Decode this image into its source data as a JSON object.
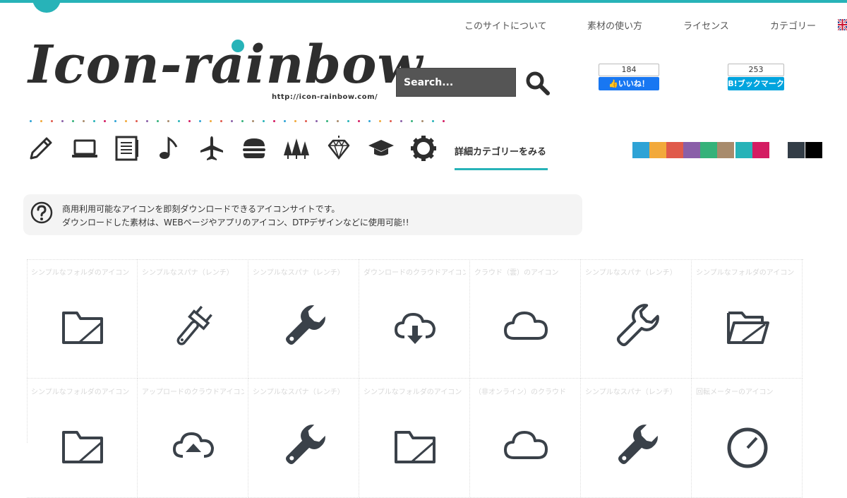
{
  "nav": {
    "items": [
      "このサイトについて",
      "素材の使い方",
      "ライセンス",
      "カテゴリー"
    ]
  },
  "logo": {
    "text": "Icon-rainbow",
    "url": "http://icon-rainbow.com/"
  },
  "search": {
    "placeholder": "Search..."
  },
  "social": {
    "facebook": {
      "count": "184",
      "label": "いいね！"
    },
    "hatena": {
      "count": "253",
      "label": "B!ブックマーク"
    }
  },
  "categories": {
    "icons": [
      "pencil-icon",
      "laptop-icon",
      "notebook-icon",
      "music-note-icon",
      "airplane-icon",
      "hamburger-icon",
      "trees-icon",
      "diamond-icon",
      "graduation-cap-icon",
      "gear-icon"
    ],
    "detail_link": "詳細カテゴリーをみる"
  },
  "colors": {
    "accent": "#27b3b8",
    "swatches": [
      "#2ea3d6",
      "#f2a93b",
      "#e05a4b",
      "#8a5fa8",
      "#35b27a",
      "#a88b6c",
      "#27b3b8",
      "#d41c62",
      "#ffffff",
      "#333d47",
      "#000000"
    ]
  },
  "info": {
    "line1": "商用利用可能なアイコンを即刻ダウンロードできるアイコンサイトです。",
    "line2": "ダウンロードした素材は、WEBページやアプリのアイコン、DTPデザインなどに使用可能!!"
  },
  "icon_grid": {
    "row1": [
      {
        "title": "シンプルなフォルダのアイコン",
        "icon": "folder-icon"
      },
      {
        "title": "シンプルなスパナ（レンチ）",
        "icon": "adjustable-wrench-icon"
      },
      {
        "title": "シンプルなスパナ（レンチ）",
        "icon": "wrench-icon"
      },
      {
        "title": "ダウンロードのクラウドアイコン",
        "icon": "cloud-download-icon"
      },
      {
        "title": "クラウド（雲）のアイコン",
        "icon": "cloud-icon"
      },
      {
        "title": "シンプルなスパナ（レンチ）",
        "icon": "wrench-outline-icon"
      },
      {
        "title": "シンプルなフォルダのアイコン",
        "icon": "open-folder-icon"
      }
    ],
    "row2": [
      {
        "title": "シンプルなフォルダのアイコン",
        "icon": "folder-icon"
      },
      {
        "title": "アップロードのクラウドアイコン",
        "icon": "cloud-upload-icon"
      },
      {
        "title": "シンプルなスパナ（レンチ）",
        "icon": "wrench-icon"
      },
      {
        "title": "シンプルなフォルダのアイコン",
        "icon": "folder-icon"
      },
      {
        "title": "（非オンライン）のクラウド",
        "icon": "cloud-icon"
      },
      {
        "title": "シンプルなスパナ（レンチ）",
        "icon": "wrench-icon"
      },
      {
        "title": "回転メーターのアイコン",
        "icon": "meter-icon"
      }
    ]
  }
}
